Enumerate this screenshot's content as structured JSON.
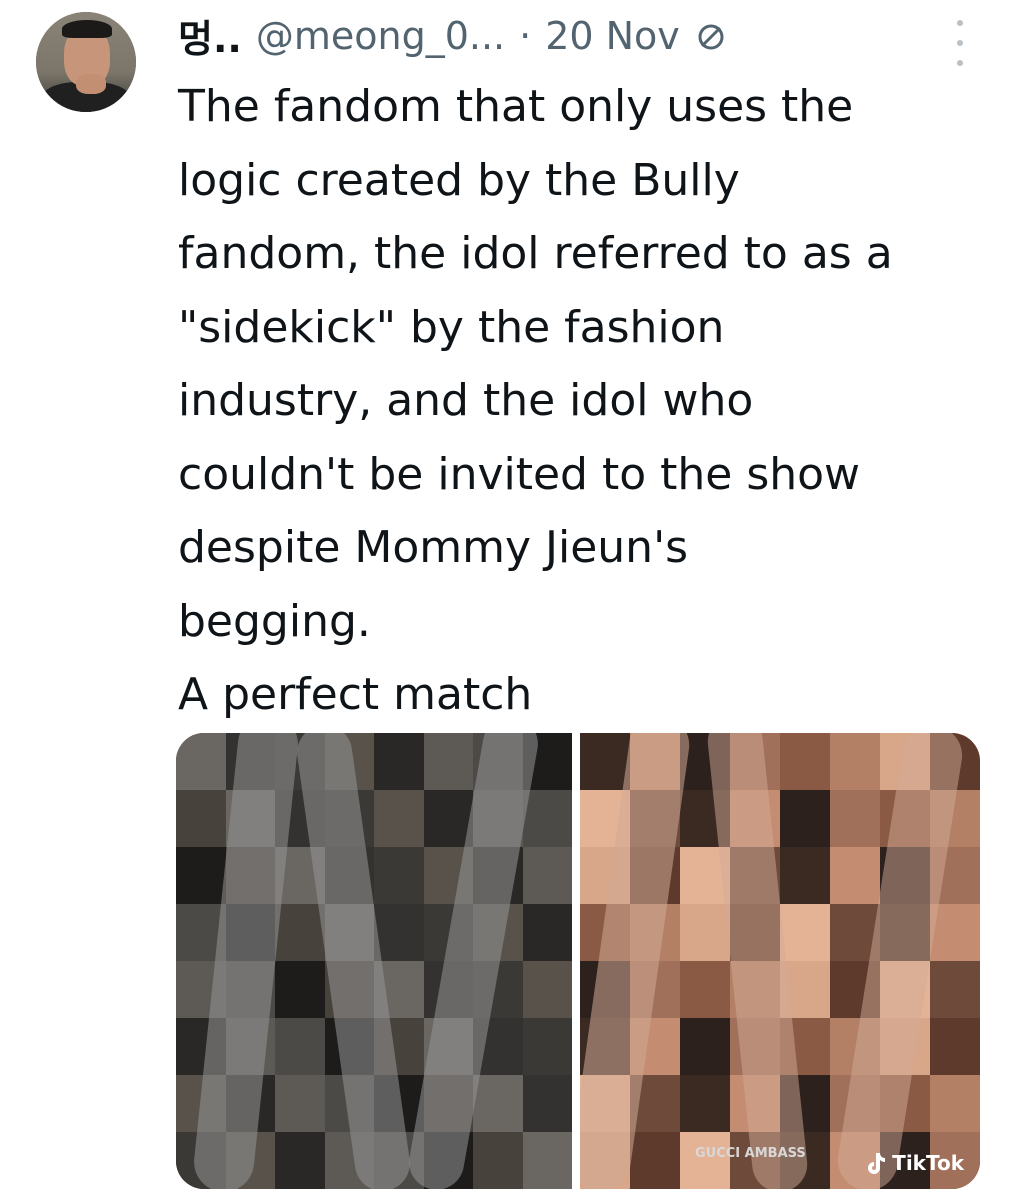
{
  "tweet": {
    "author_name": "멍..",
    "handle": "@meong_0...",
    "separator": "·",
    "date": "20 Nov",
    "text_lines": [
      "The fandom that only uses the",
      "logic created by the Bully",
      "fandom, the idol referred to as a",
      "\"sidekick\" by the fashion",
      "industry, and the idol who",
      "couldn't be invited to the show",
      "despite Mommy Jieun's",
      "begging.",
      "A perfect match"
    ]
  },
  "media": {
    "right_watermark_text": "GUCCI AMBASS",
    "tiktok_label": "TikTok"
  },
  "colors": {
    "text": "#0f1419",
    "muted": "#536471"
  }
}
